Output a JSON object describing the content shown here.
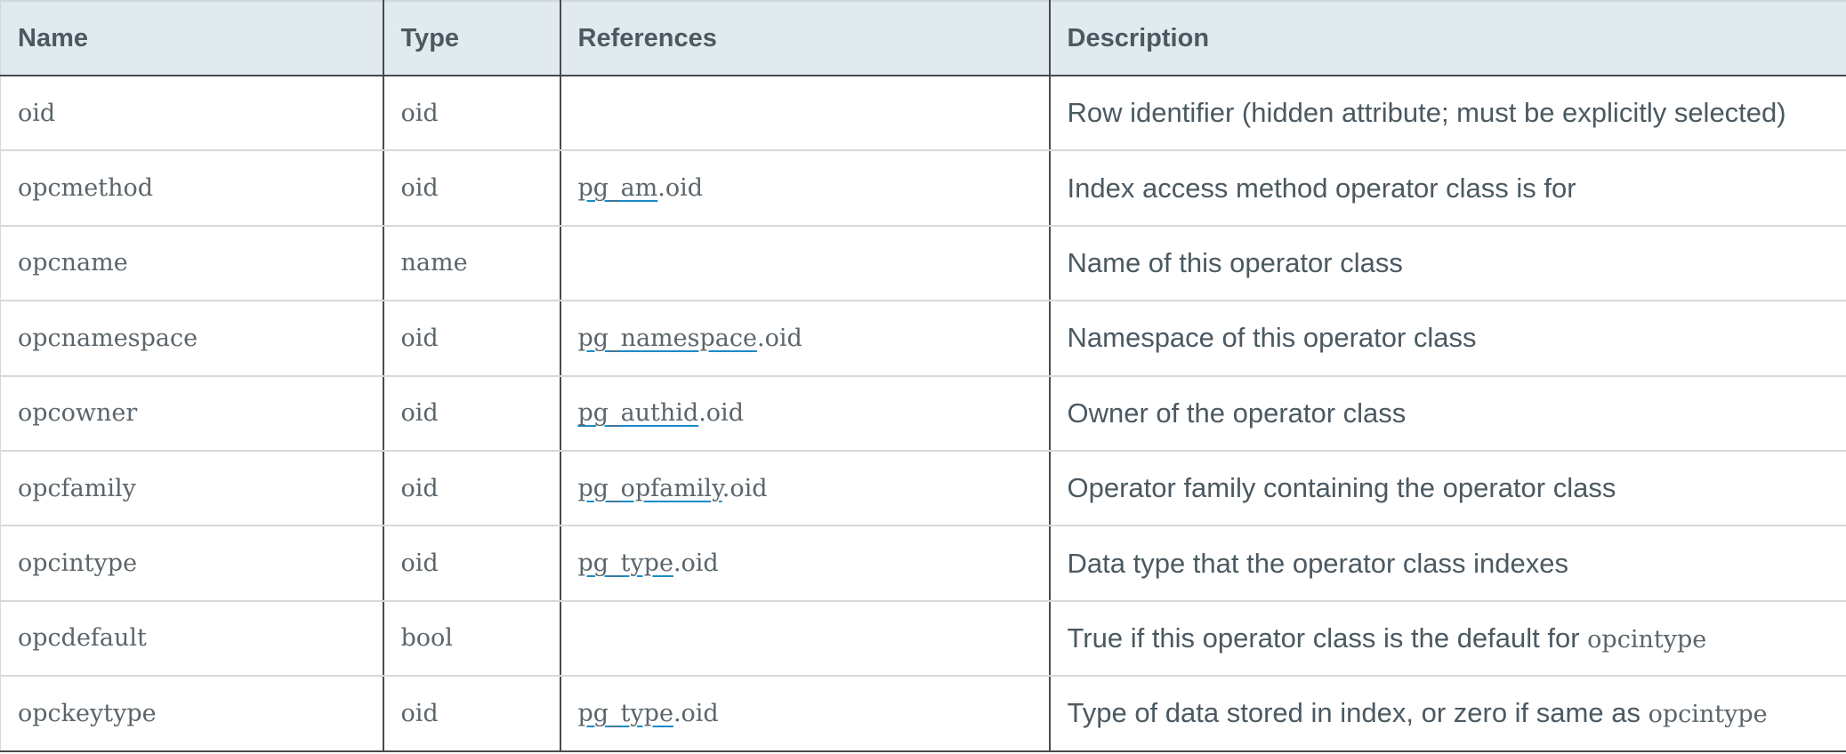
{
  "table": {
    "headers": {
      "name": "Name",
      "type": "Type",
      "references": "References",
      "description": "Description"
    },
    "rows": [
      {
        "name": "oid",
        "type": "oid",
        "ref_table": "",
        "ref_col": "",
        "desc": "Row identifier (hidden attribute; must be explicitly selected)",
        "desc_code": ""
      },
      {
        "name": "opcmethod",
        "type": "oid",
        "ref_table": "pg_am",
        "ref_col": ".oid",
        "desc": "Index access method operator class is for",
        "desc_code": ""
      },
      {
        "name": "opcname",
        "type": "name",
        "ref_table": "",
        "ref_col": "",
        "desc": "Name of this operator class",
        "desc_code": ""
      },
      {
        "name": "opcnamespace",
        "type": "oid",
        "ref_table": "pg_namespace",
        "ref_col": ".oid",
        "desc": "Namespace of this operator class",
        "desc_code": ""
      },
      {
        "name": "opcowner",
        "type": "oid",
        "ref_table": "pg_authid",
        "ref_col": ".oid",
        "desc": "Owner of the operator class",
        "desc_code": ""
      },
      {
        "name": "opcfamily",
        "type": "oid",
        "ref_table": "pg_opfamily",
        "ref_col": ".oid",
        "desc": "Operator family containing the operator class",
        "desc_code": ""
      },
      {
        "name": "opcintype",
        "type": "oid",
        "ref_table": "pg_type",
        "ref_col": ".oid",
        "desc": "Data type that the operator class indexes",
        "desc_code": ""
      },
      {
        "name": "opcdefault",
        "type": "bool",
        "ref_table": "",
        "ref_col": "",
        "desc": "True if this operator class is the default for ",
        "desc_code": "opcintype"
      },
      {
        "name": "opckeytype",
        "type": "oid",
        "ref_table": "pg_type",
        "ref_col": ".oid",
        "desc": "Type of data stored in index, or zero if same as ",
        "desc_code": "opcintype"
      }
    ]
  },
  "colors": {
    "header_bg": "#e1ebef",
    "text": "#4b5961",
    "link_underline": "#1a8bc9"
  }
}
